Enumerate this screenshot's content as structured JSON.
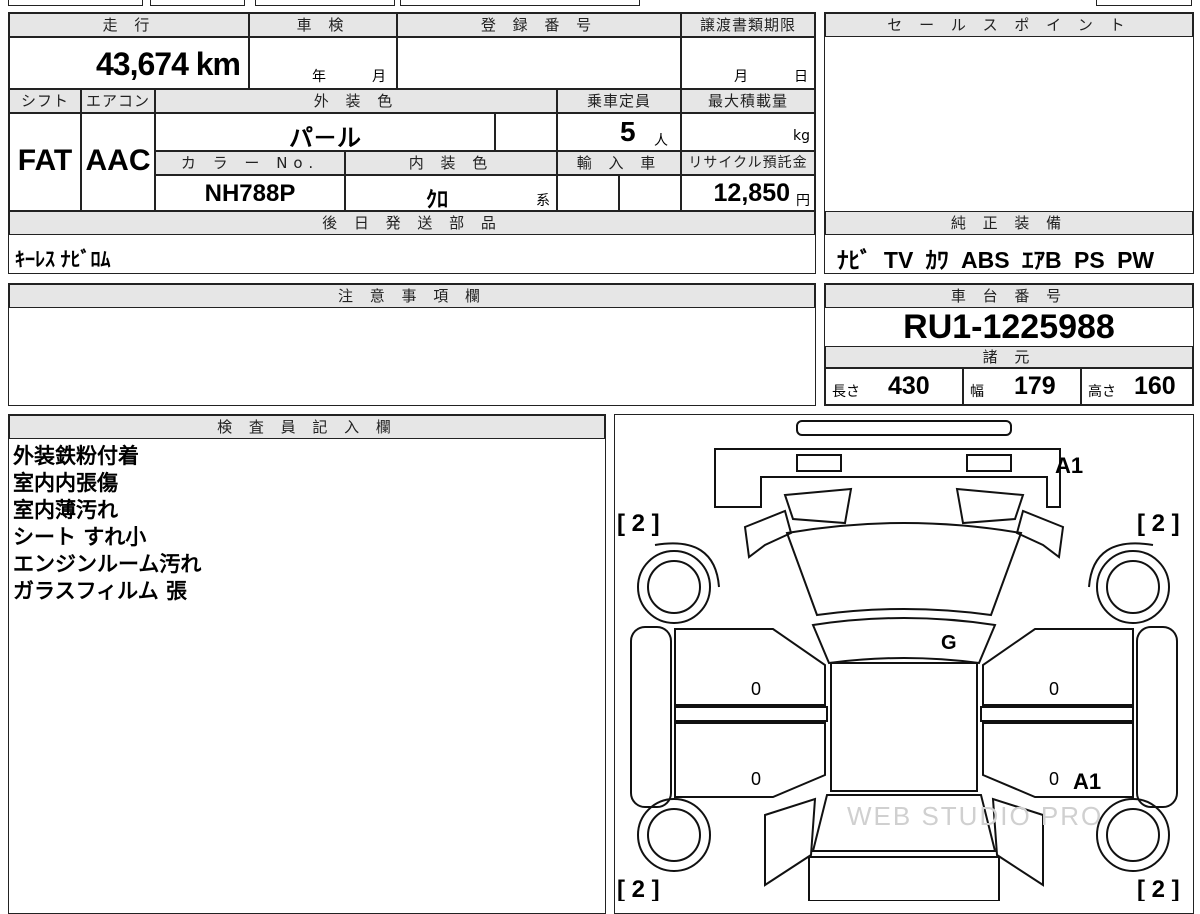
{
  "top": {
    "mileage_h": "走 行",
    "mileage_value": "43,674 km",
    "shaken_h": "車 検",
    "shaken_year": "年",
    "shaken_month": "月",
    "reg_h": "登 録 番 号",
    "transfer_h": "譲渡書類期限",
    "transfer_month": "月",
    "transfer_day": "日",
    "shift_h": "シフト",
    "ac_h": "エアコン",
    "exterior_h": "外 装 色",
    "capacity_h": "乗車定員",
    "maxload_h": "最大積載量",
    "shift_value": "FAT",
    "ac_value": "AAC",
    "exterior_value": "パ－ル",
    "capacity_value": "5",
    "capacity_unit": "人",
    "maxload_unit": "kg",
    "colorno_h": "カ ラ ー No.",
    "interior_h": "内 装 色",
    "import_h": "輸 入 車",
    "recycle_h": "リサイクル預託金",
    "colorno_value": "NH788P",
    "interior_value": "ｸﾛ",
    "interior_suffix": "系",
    "recycle_value": "12,850",
    "recycle_unit": "円",
    "parts_h": "後 日 発 送 部 品",
    "parts_value": "ｷｰﾚｽ ﾅﾋﾞﾛﾑ"
  },
  "sales": {
    "header": "セ ー ル ス ポ イ ン ト"
  },
  "equipment": {
    "header": "純 正 装 備",
    "value": "ﾅﾋﾞ TV ｶﾜ ABS ｴｱB PS PW"
  },
  "notes": {
    "header": "注 意 事 項 欄"
  },
  "chassis": {
    "header": "車 台 番 号",
    "value": "RU1-1225988"
  },
  "specs": {
    "header": "諸 元",
    "length_label": "長さ",
    "length": "430",
    "width_label": "幅",
    "width": "179",
    "height_label": "高さ",
    "height": "160"
  },
  "inspector": {
    "header": "検 査 員 記 入 欄",
    "lines": [
      "外装鉄粉付着",
      "室内内張傷",
      "室内薄汚れ",
      "シート すれ小",
      "エンジンルーム汚れ",
      "ガラスフィルム 張"
    ]
  },
  "diagram": {
    "mark_a1_top": "A1",
    "mark_a1_right": "A1",
    "mark_g": "G",
    "bracket_tl": "[ 2 ]",
    "bracket_tr": "[ 2 ]",
    "bracket_bl": "[ 2 ]",
    "bracket_br": "[ 2 ]",
    "zero_1": "0",
    "zero_2": "0",
    "zero_3": "0",
    "zero_4": "0",
    "watermark": "WEB STUDIO PRO"
  }
}
